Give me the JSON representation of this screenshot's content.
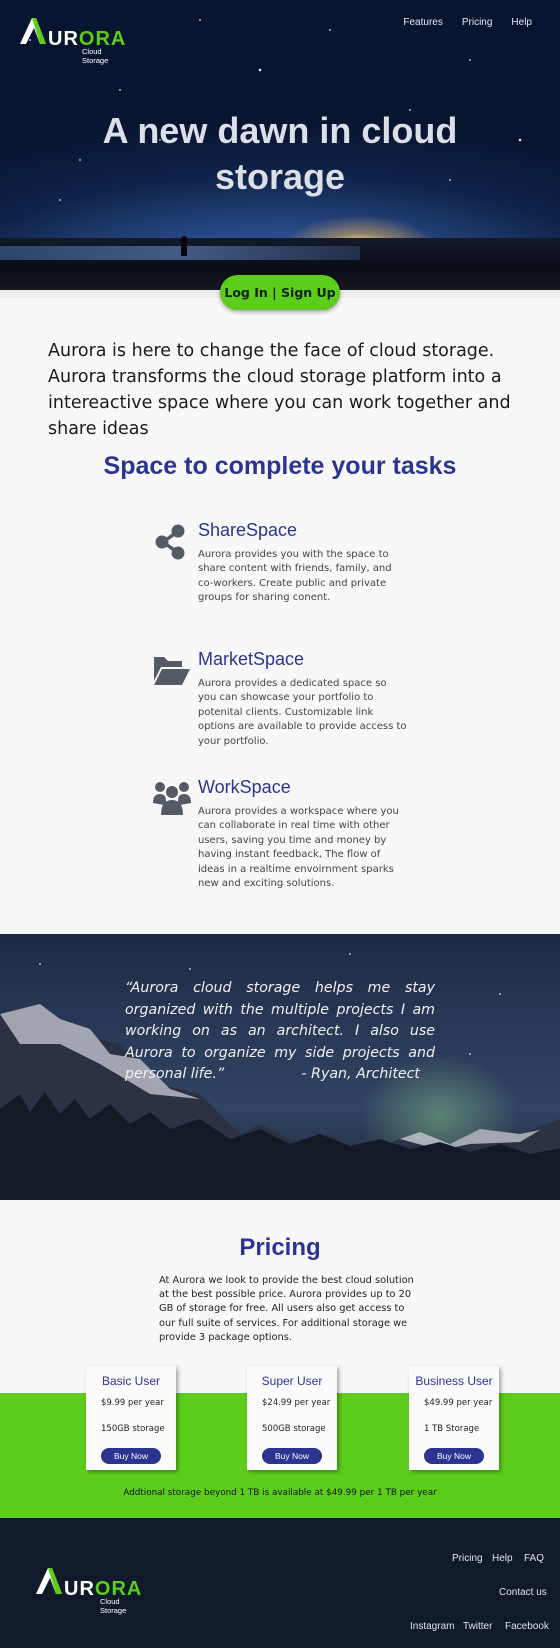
{
  "brand": {
    "name_prefix": "A",
    "name_white": "UR",
    "name_green": "ORA",
    "tagline": "Cloud Storage",
    "colors": {
      "green": "#5ccd1b",
      "navy": "#2b3591",
      "footer": "#111a2b"
    }
  },
  "nav": {
    "features": "Features",
    "pricing": "Pricing",
    "help": "Help"
  },
  "hero": {
    "title": "A new dawn in cloud storage",
    "cta": "Log In | Sign Up"
  },
  "intro": "Aurora is here to change the face of cloud storage. Aurora transforms the cloud storage platform into a intereactive space where you can work together and share ideas",
  "features": {
    "title": "Space to complete your tasks",
    "items": [
      {
        "icon": "share-icon",
        "title": "ShareSpace",
        "desc": "Aurora provides you with the space to share content with friends, family, and co-workers. Create public and private groups for sharing conent."
      },
      {
        "icon": "folder-open-icon",
        "title": "MarketSpace",
        "desc": "Aurora provides a dedicated space so you can showcase your portfolio to potenital clients. Customizable link options are available to provide access to your portfolio."
      },
      {
        "icon": "users-icon",
        "title": "WorkSpace",
        "desc": "Aurora provides a workspace where you  can collaborate in real time with other users, saving you time and money by having instant feedback, The flow of ideas in a realtime envoirnment sparks new and exciting solutions."
      }
    ]
  },
  "testimonial": {
    "quote": "“Aurora cloud storage helps me stay organized with the multiple projects I am working on as an architect. I also use Aurora to organize my side projects and personal life.”",
    "author": "- Ryan, Architect"
  },
  "pricing": {
    "title": "Pricing",
    "desc": "At Aurora we look to provide the best cloud solution at the best possible price. Aurora provides up to 20 GB of storage for free. All users also get access to our full suite of services. For additional storage we provide 3 package options.",
    "plans": [
      {
        "name": "Basic User",
        "price": "$9.99 per year",
        "storage": "150GB storage",
        "button": "Buy Now"
      },
      {
        "name": "Super User",
        "price": "$24.99 per year",
        "storage": "500GB storage",
        "button": "Buy Now"
      },
      {
        "name": "Business User",
        "price": "$49.99 per year",
        "storage": "1 TB Storage",
        "button": "Buy Now"
      }
    ],
    "note": "Addtional storage beyond 1 TB is available at $49.99 per 1 TB per year"
  },
  "footer": {
    "links": {
      "pricing": "Pricing",
      "help": "Help",
      "faq": "FAQ",
      "contact": "Contact us",
      "instagram": "Instagram",
      "twitter": "Twitter",
      "facebook": "Facebook"
    }
  }
}
